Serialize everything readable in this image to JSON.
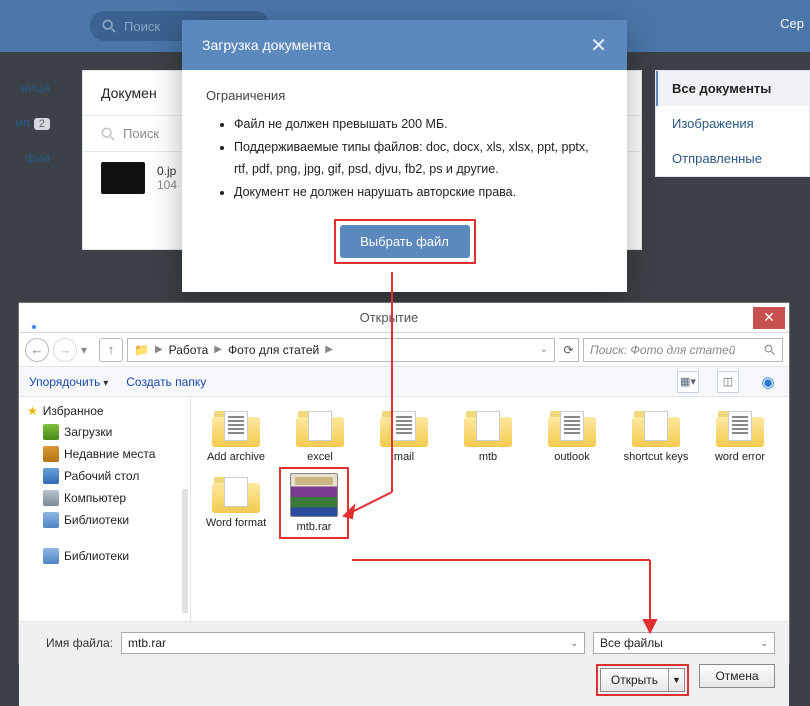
{
  "vk": {
    "top_search_placeholder": "Поиск",
    "user_partial": "Сер",
    "sidebar_left": [
      "ница",
      "ия",
      "фии"
    ],
    "sidebar_left_badge": "2",
    "panel_title": "Докумен",
    "panel_search": "Поиск",
    "file_name": "0.jp",
    "file_size": "104",
    "right_nav": {
      "all": "Все документы",
      "images": "Изображения",
      "sent": "Отправленные"
    }
  },
  "modal": {
    "title": "Загрузка документа",
    "restrictions_header": "Ограничения",
    "bullet1": "Файл не должен превышать 200 МБ.",
    "bullet2": "Поддерживаемые типы файлов: doc, docx, xls, xlsx, ppt, pptx, rtf, pdf, png, jpg, gif, psd, djvu, fb2, ps и другие.",
    "bullet3": "Документ не должен нарушать авторские права.",
    "choose_file": "Выбрать файл"
  },
  "filedlg": {
    "title": "Открытие",
    "path_seg1": "Работа",
    "path_seg2": "Фото для статей",
    "search_placeholder": "Поиск: Фото для статей",
    "organize": "Упорядочить",
    "new_folder": "Создать папку",
    "tree": {
      "favorites": "Избранное",
      "downloads": "Загрузки",
      "recent": "Недавние места",
      "desktop": "Рабочий стол",
      "computer": "Компьютер",
      "libraries": "Библиотеки",
      "libraries2": "Библиотеки"
    },
    "files": [
      "Add archive",
      "excel",
      "mail",
      "mtb",
      "outlook",
      "shortcut keys",
      "word error",
      "Word format",
      "mtb.rar"
    ],
    "filename_label": "Имя файла:",
    "filename_value": "mtb.rar",
    "filter": "Все файлы",
    "open": "Открыть",
    "cancel": "Отмена"
  }
}
